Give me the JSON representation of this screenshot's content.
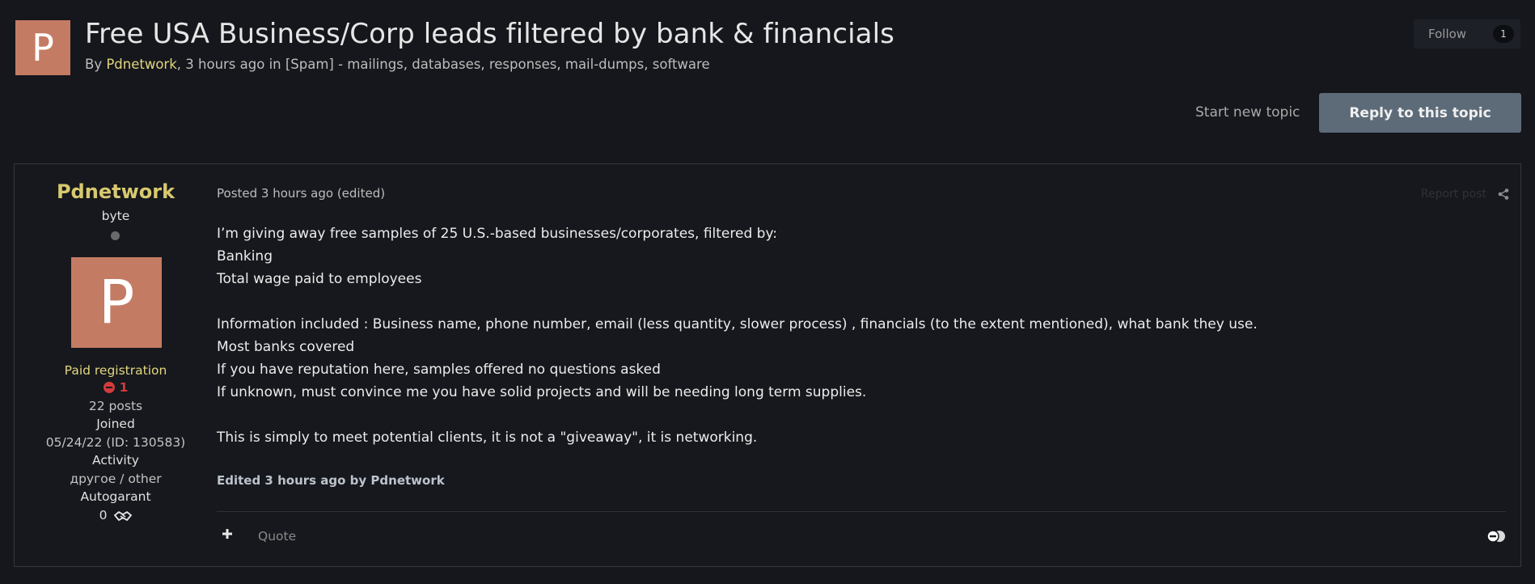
{
  "topic": {
    "avatar_letter": "P",
    "title": "Free USA Business/Corp leads filtered by bank & financials",
    "by_prefix": "By ",
    "author": "Pdnetwork",
    "byline_suffix": ", 3 hours ago in [Spam] - mailings, databases, responses, mail-dumps, software",
    "follow_label": "Follow",
    "follow_count": "1",
    "start_topic_label": "Start new topic",
    "reply_label": "Reply to this topic"
  },
  "post": {
    "author": {
      "name": "Pdnetwork",
      "rank": "byte",
      "avatar_letter": "P",
      "group": "Paid registration",
      "reputation": "1",
      "posts": "22 posts",
      "joined_label": "Joined",
      "joined_value": "05/24/22 (ID: 130583)",
      "activity_label": "Activity",
      "activity_value": "другое / other",
      "autogarant_label": "Autogarant",
      "autogarant_value": "0"
    },
    "meta": "Posted 3 hours ago (edited)",
    "report_label": "Report post",
    "body_lines": [
      "I’m giving away free samples of 25 U.S.-based businesses/corporates, filtered by:",
      "Banking",
      "Total wage paid to employees",
      "",
      "Information included : Business name, phone number, email (less quantity, slower process) , financials (to the extent mentioned), what bank they use.",
      "Most banks covered",
      "If you have reputation here, samples offered no questions asked",
      "If unknown, must convince me you have solid projects and will be needing long term supplies.",
      "",
      "This is simply to meet potential clients, it is not a \"giveaway\", it is networking."
    ],
    "edited_note": "Edited 3 hours ago by Pdnetwork",
    "quote_label": "Quote"
  },
  "icons": {
    "share": "share-icon",
    "plus": "plus-icon",
    "reaction": "reaction-icon",
    "handshake": "handshake-icon",
    "reputation": "minus-circle-icon"
  },
  "colors": {
    "background": "#15171c",
    "accent_author": "#d8c96f",
    "avatar": "#c47b63",
    "reply_button": "#5d6b79",
    "reputation_negative": "#d13b3b"
  }
}
